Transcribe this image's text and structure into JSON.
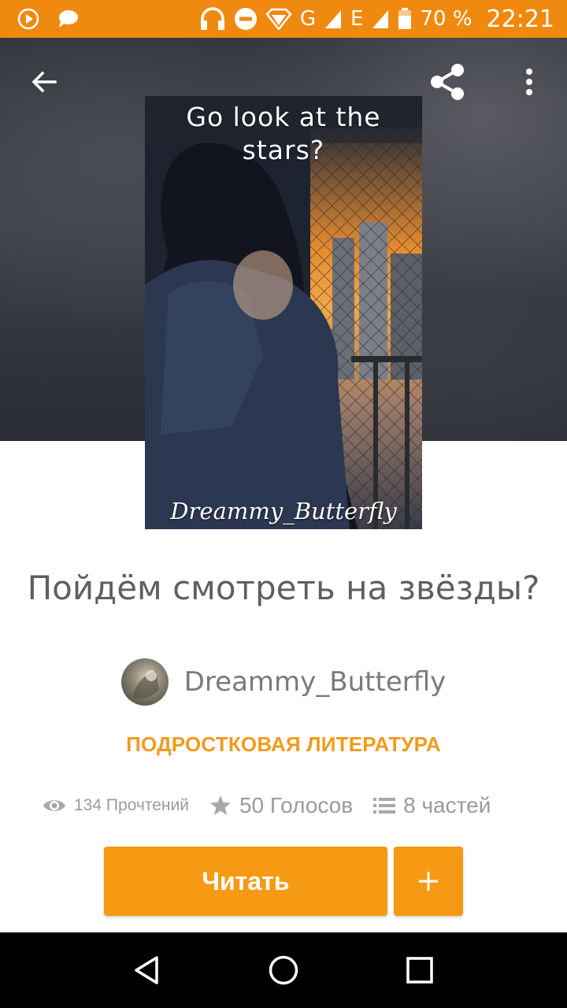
{
  "status_bar": {
    "network_g": "G",
    "network_e": "E",
    "battery": "70 %",
    "time": "22:21"
  },
  "cover": {
    "title_line1": "Go look at the",
    "title_line2": "stars?",
    "signature": "Dreammy_Butterfly"
  },
  "story": {
    "title": "Пойдём смотреть на звёзды?",
    "author": "Dreammy_Butterfly",
    "category": "ПОДРОСТКОВАЯ ЛИТЕРАТУРА"
  },
  "stats": {
    "reads": "134 Прочтений",
    "votes": "50 Голосов",
    "parts": "8 частей"
  },
  "actions": {
    "read_label": "Читать",
    "add_label": "+"
  },
  "icons": {
    "back": "arrow-left-icon",
    "share": "share-icon",
    "more": "more-vertical-icon",
    "reads": "eye-icon",
    "votes": "star-icon",
    "parts": "list-icon"
  },
  "colors": {
    "status_bar": "#f0890f",
    "accent": "#f79a13",
    "category": "#f29a1c",
    "title_text": "#5f5f5f",
    "muted": "#9a9a9a"
  }
}
